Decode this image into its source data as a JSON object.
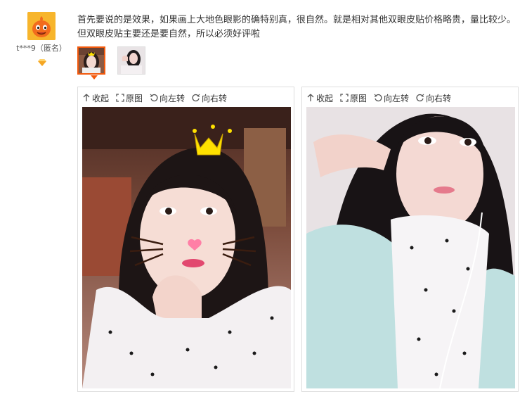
{
  "user": {
    "name": "t***9（匿名）",
    "avatar_icon": "orange-cartoon-avatar",
    "badge_icon": "diamond-icon",
    "badge_color": "#f5a623"
  },
  "review": {
    "text": "首先要说的是效果，如果画上大地色眼影的确特别真，很自然。就是相对其他双眼皮贴价格略贵，量比较少。但双眼皮贴主要还是要自然，所以必须好评啦"
  },
  "thumbnails": [
    {
      "state": "selected"
    },
    {
      "state": "normal"
    }
  ],
  "viewers": [
    {
      "toolbar": {
        "collapse": "收起",
        "original": "原图",
        "rotate_left": "向左转",
        "rotate_right": "向右转"
      }
    },
    {
      "toolbar": {
        "collapse": "收起",
        "original": "原图",
        "rotate_left": "向左转",
        "rotate_right": "向右转"
      }
    }
  ],
  "colors": {
    "accent": "#f2590c",
    "border": "#dddddd"
  }
}
